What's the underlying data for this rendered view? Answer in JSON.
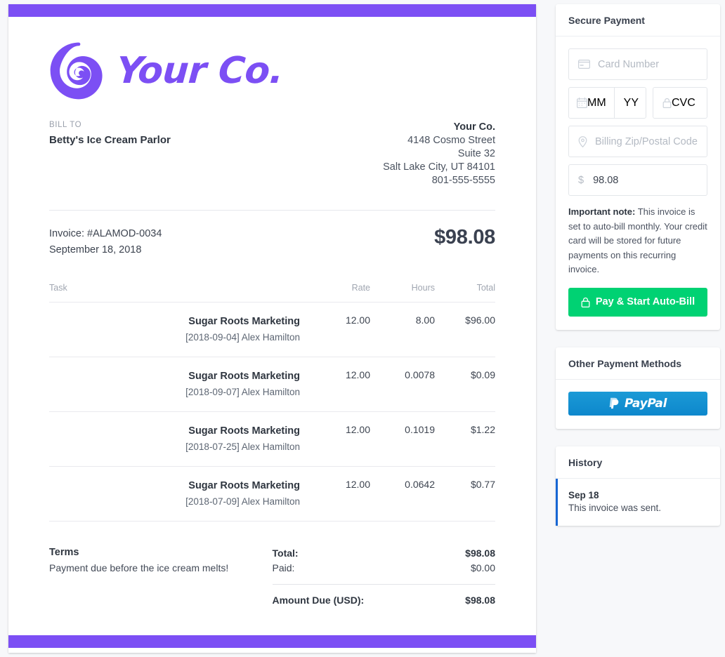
{
  "theme": {
    "accent_purple": "#7c4ff4",
    "pay_green": "#00d273",
    "paypal_blue": "#0d87cc",
    "history_blue": "#1766d3"
  },
  "invoice": {
    "logo_text": "Your Co.",
    "logo_icon": "spiral-logo-icon",
    "bill_to_label": "BILL TO",
    "bill_to_name": "Betty's Ice Cream Parlor",
    "from": {
      "company": "Your Co.",
      "street": "4148 Cosmo Street",
      "suite": "Suite 32",
      "city_state_zip": "Salt Lake City, UT 84101",
      "phone": "801-555-5555"
    },
    "number_line": "Invoice: #ALAMOD-0034",
    "date_line": "September 18, 2018",
    "amount_big": "$98.08",
    "columns": {
      "task": "Task",
      "rate": "Rate",
      "hours": "Hours",
      "total": "Total"
    },
    "rows": [
      {
        "task": "Sugar Roots Marketing",
        "sub": "[2018-09-04] Alex Hamilton",
        "rate": "12.00",
        "hours": "8.00",
        "total": "$96.00"
      },
      {
        "task": "Sugar Roots Marketing",
        "sub": "[2018-09-07] Alex Hamilton",
        "rate": "12.00",
        "hours": "0.0078",
        "total": "$0.09"
      },
      {
        "task": "Sugar Roots Marketing",
        "sub": "[2018-07-25] Alex Hamilton",
        "rate": "12.00",
        "hours": "0.1019",
        "total": "$1.22"
      },
      {
        "task": "Sugar Roots Marketing",
        "sub": "[2018-07-09] Alex Hamilton",
        "rate": "12.00",
        "hours": "0.0642",
        "total": "$0.77"
      }
    ],
    "terms_heading": "Terms",
    "terms_text": "Payment due before the ice cream melts!",
    "totals": {
      "total_label": "Total:",
      "total_value": "$98.08",
      "paid_label": "Paid:",
      "paid_value": "$0.00",
      "due_label": "Amount Due (USD):",
      "due_value": "$98.08"
    }
  },
  "secure_payment": {
    "title": "Secure Payment",
    "card_number_placeholder": "Card Number",
    "mm_placeholder": "MM",
    "yy_placeholder": "YY",
    "cvc_placeholder": "CVC",
    "zip_placeholder": "Billing Zip/Postal Code",
    "currency_symbol": "$",
    "amount_value": "98.08",
    "note_label": "Important note:",
    "note_text": " This invoice is set to auto-bill monthly. Your credit card will be stored for future payments on this recurring invoice.",
    "pay_button": "Pay & Start Auto-Bill"
  },
  "other_payment": {
    "title": "Other Payment Methods",
    "paypal_label": "PayPal"
  },
  "history": {
    "title": "History",
    "entries": [
      {
        "date": "Sep 18",
        "text": "This invoice was sent."
      }
    ]
  }
}
